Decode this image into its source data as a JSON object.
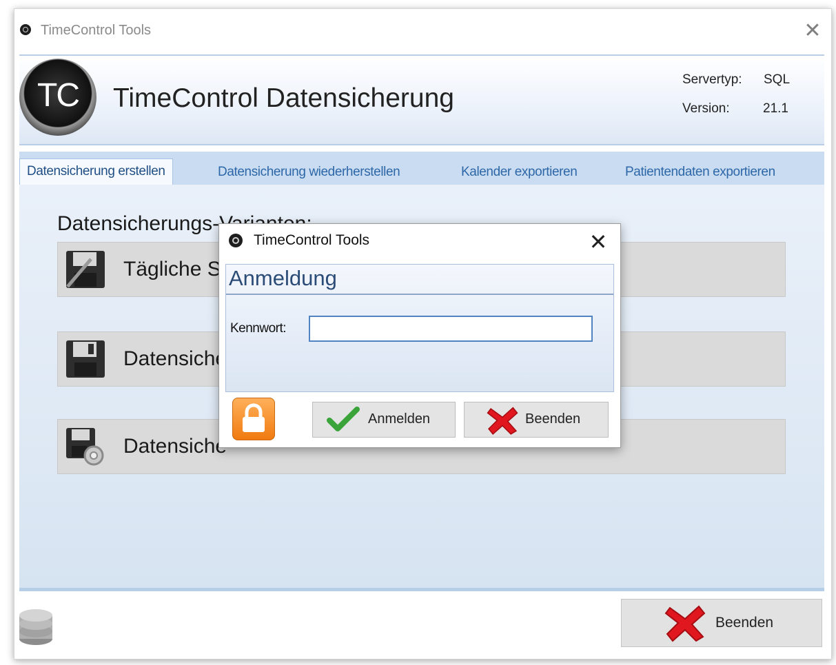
{
  "window": {
    "title": "TimeControl Tools",
    "close_glyph": "✕"
  },
  "header": {
    "logo_text": "TC",
    "title": "TimeControl Datensicherung",
    "server_label": "Servertyp:",
    "server_value": "SQL",
    "version_label": "Version:",
    "version_value": "21.1"
  },
  "tabs": [
    {
      "label": "Datensicherung erstellen",
      "active": true
    },
    {
      "label": "Datensicherung wiederherstellen",
      "active": false
    },
    {
      "label": "Kalender exportieren",
      "active": false
    },
    {
      "label": "Patientendaten exportieren",
      "active": false
    }
  ],
  "main": {
    "section_heading": "Datensicherungs-Varianten:",
    "options": [
      {
        "label": "Tägliche S",
        "icon": "floppy-pen-icon"
      },
      {
        "label": "Datensiche",
        "icon": "floppy-disk-icon"
      },
      {
        "label": "Datensiche",
        "icon": "floppy-gear-icon"
      }
    ],
    "exit_label": "Beenden"
  },
  "dialog": {
    "title": "TimeControl Tools",
    "close_glyph": "✕",
    "heading": "Anmeldung",
    "password_label": "Kennwort:",
    "password_value": "",
    "login_label": "Anmelden",
    "exit_label": "Beenden"
  },
  "colors": {
    "accent": "#2d67a8",
    "header_border": "#b9cfe9",
    "tabstrip": "#c9dcf1",
    "input_border": "#4f83c2",
    "lock_orange": "#f07a10",
    "check_green": "#3aa33a",
    "cross_red": "#e0171f"
  }
}
